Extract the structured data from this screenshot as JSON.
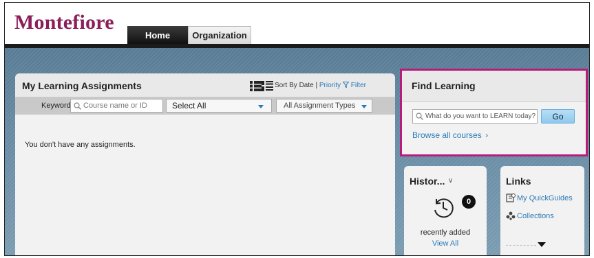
{
  "header": {
    "logo": "Montefiore",
    "tabs": [
      {
        "label": "Home",
        "active": true
      },
      {
        "label": "Organization",
        "active": false
      }
    ]
  },
  "assignments": {
    "title": "My Learning Assignments",
    "sort_prefix": "Sort By Date |",
    "sort_priority": "Priority",
    "filter": "Filter",
    "keyword_label": "Keyword",
    "keyword_placeholder": "Course name or ID",
    "select_all": "Select All",
    "assignment_types": "All Assignment Types",
    "empty_message": "You don't have any assignments."
  },
  "find_learning": {
    "title": "Find Learning",
    "search_placeholder": "What do you want to LEARN today?",
    "go_label": "Go",
    "browse_label": "Browse all courses"
  },
  "history": {
    "title": "Histor...",
    "badge_count": "0",
    "recent_label": "recently added",
    "view_all": "View All"
  },
  "links": {
    "title": "Links",
    "items": [
      {
        "label": "My QuickGuides",
        "icon": "quickguide-icon"
      },
      {
        "label": "Collections",
        "icon": "collections-icon"
      }
    ]
  },
  "colors": {
    "brand": "#8c1e5a",
    "highlight_border": "#b71c7b",
    "link": "#2a7ab8"
  }
}
